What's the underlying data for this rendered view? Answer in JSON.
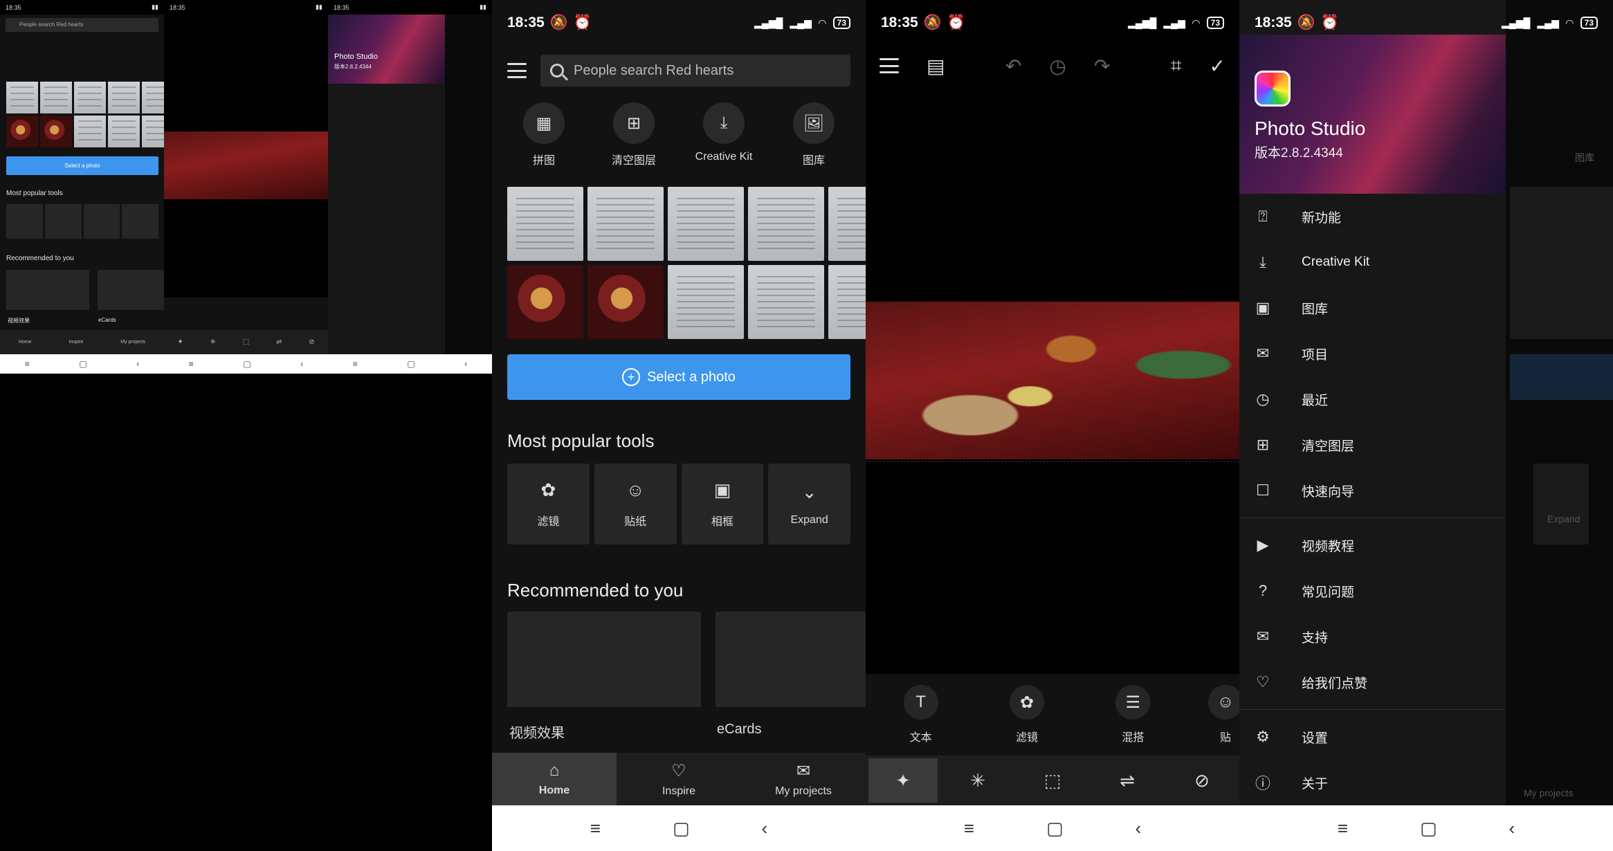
{
  "status": {
    "time": "18:35",
    "battery": "73"
  },
  "home": {
    "search_placeholder": "People search Red hearts",
    "quick": [
      {
        "label": "拼图",
        "icon": "collage-icon"
      },
      {
        "label": "清空图层",
        "icon": "layer-add-icon"
      },
      {
        "label": "Creative Kit",
        "icon": "download-icon"
      },
      {
        "label": "图库",
        "icon": "gallery-icon"
      }
    ],
    "select_label": "Select a photo",
    "popular_title": "Most popular tools",
    "tools": [
      {
        "label": "滤镜",
        "icon": "flower-icon"
      },
      {
        "label": "贴纸",
        "icon": "sticker-icon"
      },
      {
        "label": "相框",
        "icon": "frame-icon"
      },
      {
        "label": "Expand",
        "icon": "chevron-down-icon"
      }
    ],
    "recommended_title": "Recommended to you",
    "recommended": [
      {
        "label": "视频效果"
      },
      {
        "label": "eCards"
      }
    ],
    "tabs": [
      {
        "label": "Home",
        "icon": "home-icon"
      },
      {
        "label": "Inspire",
        "icon": "heart-chat-icon"
      },
      {
        "label": "My projects",
        "icon": "inbox-icon"
      }
    ]
  },
  "editor": {
    "tools": [
      {
        "label": "文本",
        "icon": "text-icon"
      },
      {
        "label": "滤镜",
        "icon": "flower-icon"
      },
      {
        "label": "混搭",
        "icon": "stack-icon"
      },
      {
        "label": "贴",
        "icon": "sticker-icon"
      }
    ]
  },
  "drawer": {
    "app_name": "Photo Studio",
    "version": "版本2.8.2.4344",
    "items_a": [
      {
        "label": "新功能",
        "icon": "new-features-icon"
      },
      {
        "label": "Creative Kit",
        "icon": "download-icon"
      },
      {
        "label": "图库",
        "icon": "gallery-icon"
      },
      {
        "label": "项目",
        "icon": "inbox-icon"
      },
      {
        "label": "最近",
        "icon": "history-icon"
      },
      {
        "label": "清空图层",
        "icon": "layer-add-icon"
      },
      {
        "label": "快速向导",
        "icon": "wizard-icon"
      }
    ],
    "items_b": [
      {
        "label": "视频教程",
        "icon": "video-icon"
      },
      {
        "label": "常见问题",
        "icon": "faq-icon"
      },
      {
        "label": "支持",
        "icon": "mail-icon"
      },
      {
        "label": "给我们点赞",
        "icon": "heart-icon"
      }
    ],
    "items_c": [
      {
        "label": "设置",
        "icon": "gear-icon"
      },
      {
        "label": "关于",
        "icon": "info-icon"
      }
    ],
    "ghost_expand": "Expand",
    "ghost_tab": "My projects",
    "ghost_gallery": "图库"
  },
  "thumbs": {
    "select_label": "Select a photo",
    "popular_title": "Most popular tools",
    "recommended_title": "Recommended to you",
    "rec1": "视频效果",
    "rec2": "eCards",
    "search": "People search Red hearts",
    "app": "Photo Studio",
    "version": "版本2.8.2.4344"
  }
}
